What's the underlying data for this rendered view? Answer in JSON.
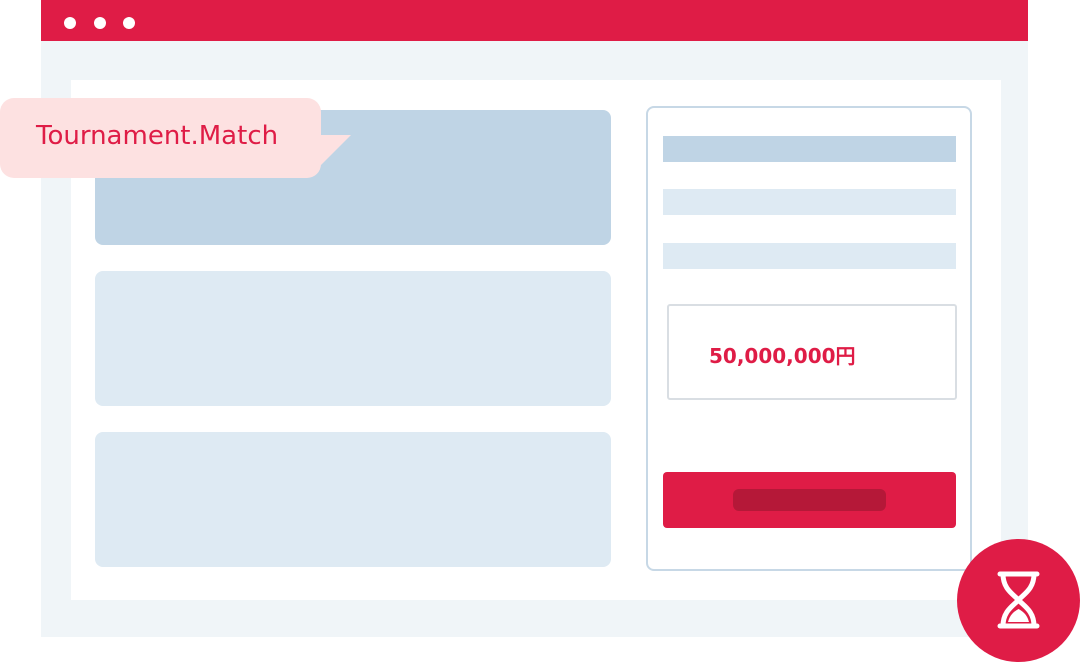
{
  "tooltip": {
    "text": "Tournament.Match"
  },
  "side_panel": {
    "amount": "50,000,000円"
  },
  "icons": {
    "window_controls": "window-dots-icon",
    "timer": "hourglass-icon"
  },
  "colors": {
    "accent": "#df1c46",
    "accent_dark": "#b51838",
    "tooltip_bg": "#fde1e1",
    "block_highlight": "#bfd4e5",
    "block_muted": "#deeaf3",
    "window_bg": "#f0f5f8"
  }
}
